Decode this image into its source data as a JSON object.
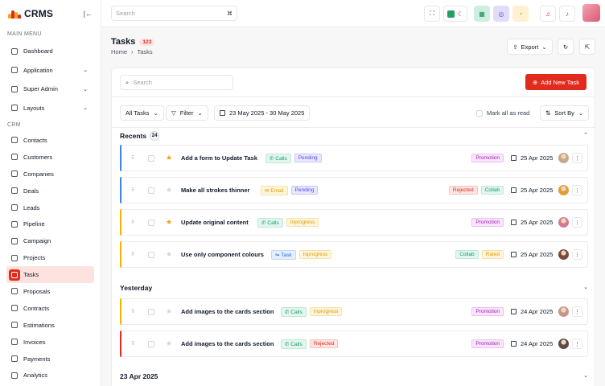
{
  "app": {
    "name": "CRMS"
  },
  "sidebar": {
    "main_menu_label": "MAIN MENU",
    "main_items": [
      {
        "label": "Dashboard",
        "icon": "dashboard-icon"
      },
      {
        "label": "Application",
        "icon": "application-icon"
      },
      {
        "label": "Super Admin",
        "icon": "user-cog-icon"
      },
      {
        "label": "Layouts",
        "icon": "layout-icon"
      }
    ],
    "crm_label": "CRM",
    "crm_items": [
      {
        "label": "Contacts",
        "icon": "contacts-icon"
      },
      {
        "label": "Customers",
        "icon": "customers-icon"
      },
      {
        "label": "Companies",
        "icon": "building-icon"
      },
      {
        "label": "Deals",
        "icon": "deals-icon"
      },
      {
        "label": "Leads",
        "icon": "leads-icon"
      },
      {
        "label": "Pipeline",
        "icon": "pipeline-icon"
      },
      {
        "label": "Campaign",
        "icon": "campaign-icon"
      },
      {
        "label": "Projects",
        "icon": "projects-icon"
      },
      {
        "label": "Tasks",
        "icon": "tasks-icon",
        "active": true
      },
      {
        "label": "Proposals",
        "icon": "proposals-icon"
      },
      {
        "label": "Contracts",
        "icon": "contracts-icon"
      },
      {
        "label": "Estimations",
        "icon": "estimations-icon"
      },
      {
        "label": "Invoices",
        "icon": "invoices-icon"
      },
      {
        "label": "Payments",
        "icon": "payments-icon"
      },
      {
        "label": "Analytics",
        "icon": "analytics-icon"
      }
    ]
  },
  "topbar": {
    "search_placeholder": "Search",
    "shortcut": "⌘"
  },
  "page": {
    "title": "Tasks",
    "count": "123",
    "breadcrumb": [
      "Home",
      "Tasks"
    ],
    "export_label": "Export"
  },
  "toolbar": {
    "search_placeholder": "Search",
    "add_label": "Add New Task",
    "all_tasks": "All Tasks",
    "filter": "Filter",
    "date_range": "23 May 2025 - 30 May 2025",
    "mark_read": "Mark all as read",
    "sort_by": "Sort By"
  },
  "groups": {
    "recents": {
      "title": "Recents",
      "count": "24"
    },
    "yesterday": {
      "title": "Yesterday"
    },
    "apr23": {
      "title": "23 Apr 2025"
    }
  },
  "tasks": [
    {
      "name": "Add a form to Update Task",
      "starred": true,
      "bar": "#3b82f6",
      "type": "Calls",
      "status": "Pending",
      "tags": [
        "Promotion"
      ],
      "date": "25 Apr 2025",
      "avatar": "#c8a88a"
    },
    {
      "name": "Make all strokes thinner",
      "starred": false,
      "bar": "#3b82f6",
      "type": "Email",
      "status": "Pending",
      "tags": [
        "Rejected",
        "Collab"
      ],
      "date": "25 Apr 2025",
      "avatar": "#e0a030"
    },
    {
      "name": "Update original content",
      "starred": true,
      "bar": "#f5b300",
      "type": "Calls",
      "status": "Inprogress",
      "tags": [
        "Promotion"
      ],
      "date": "25 Apr 2025",
      "avatar": "#d57a8c"
    },
    {
      "name": "Use only component colours",
      "starred": false,
      "bar": "#f5b300",
      "type": "Task",
      "status": "Inprogress",
      "tags": [
        "Collab",
        "Rated"
      ],
      "date": "25 Apr 2025",
      "avatar": "#7a4a3a"
    },
    {
      "name": "Add images to the cards section",
      "starred": false,
      "bar": "#f5b300",
      "type": "Calls",
      "status": "Inprogress",
      "tags": [
        "Promotion"
      ],
      "date": "24 Apr 2025",
      "avatar": "#c9958a"
    },
    {
      "name": "Add images to the cards section",
      "starred": false,
      "bar": "#e02b1d",
      "type": "Calls",
      "status": "Rejected",
      "tags": [
        "Promotion"
      ],
      "date": "24 Apr 2025",
      "avatar": "#5a4a4a"
    }
  ],
  "colors": {
    "accent": "#e02b1d",
    "star_on": "#f59e0b",
    "star_off": "#d1d5db"
  }
}
